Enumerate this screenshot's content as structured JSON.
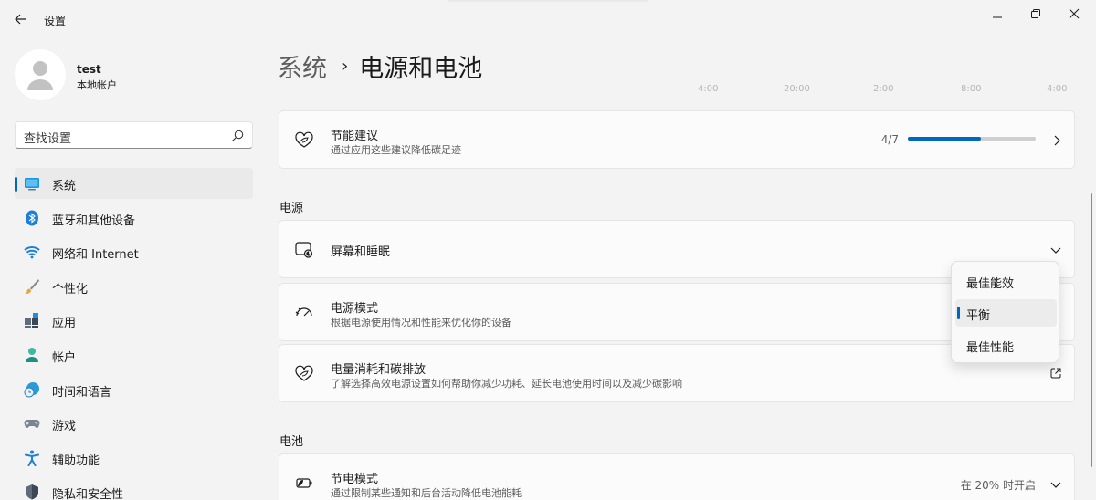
{
  "window": {
    "title": "设置"
  },
  "profile": {
    "name": "test",
    "account_type": "本地帐户"
  },
  "search": {
    "placeholder": "查找设置"
  },
  "sidebar": {
    "items": [
      {
        "label": "系统",
        "icon": "system-icon",
        "active": true
      },
      {
        "label": "蓝牙和其他设备",
        "icon": "bluetooth-icon"
      },
      {
        "label": "网络和 Internet",
        "icon": "wifi-icon"
      },
      {
        "label": "个性化",
        "icon": "brush-icon"
      },
      {
        "label": "应用",
        "icon": "apps-icon"
      },
      {
        "label": "帐户",
        "icon": "account-icon"
      },
      {
        "label": "时间和语言",
        "icon": "globe-clock-icon"
      },
      {
        "label": "游戏",
        "icon": "gamepad-icon"
      },
      {
        "label": "辅助功能",
        "icon": "accessibility-icon"
      },
      {
        "label": "隐私和安全性",
        "icon": "shield-icon"
      }
    ]
  },
  "breadcrumb": {
    "parent": "系统",
    "separator": "›",
    "current": "电源和电池"
  },
  "chart_axis_fragments": [
    "4:00",
    "20:00",
    "2:00",
    "8:00",
    "4:00"
  ],
  "cards": {
    "energy_recommendations": {
      "title": "节能建议",
      "subtitle": "通过应用这些建议降低碳足迹",
      "fraction": "4/7",
      "progress": 0.57
    },
    "screen_sleep": {
      "title": "屏幕和睡眠"
    },
    "power_mode": {
      "title": "电源模式",
      "subtitle": "根据电源使用情况和性能来优化你的设备"
    },
    "power_carbon": {
      "title": "电量消耗和碳排放",
      "subtitle": "了解选择高效电源设置如何帮助你减少功耗、延长电池使用时间以及减少碳影响"
    },
    "battery_saver": {
      "title": "节电模式",
      "subtitle": "通过限制某些通知和后台活动降低电池能耗",
      "value": "在 20% 时开启"
    }
  },
  "sections": {
    "power": "电源",
    "battery": "电池"
  },
  "power_mode_dropdown": {
    "options": [
      "最佳能效",
      "平衡",
      "最佳性能"
    ],
    "selected": "平衡"
  },
  "colors": {
    "accent": "#0067c0",
    "background": "#f3f3f3",
    "card": "#fbfbfb"
  }
}
